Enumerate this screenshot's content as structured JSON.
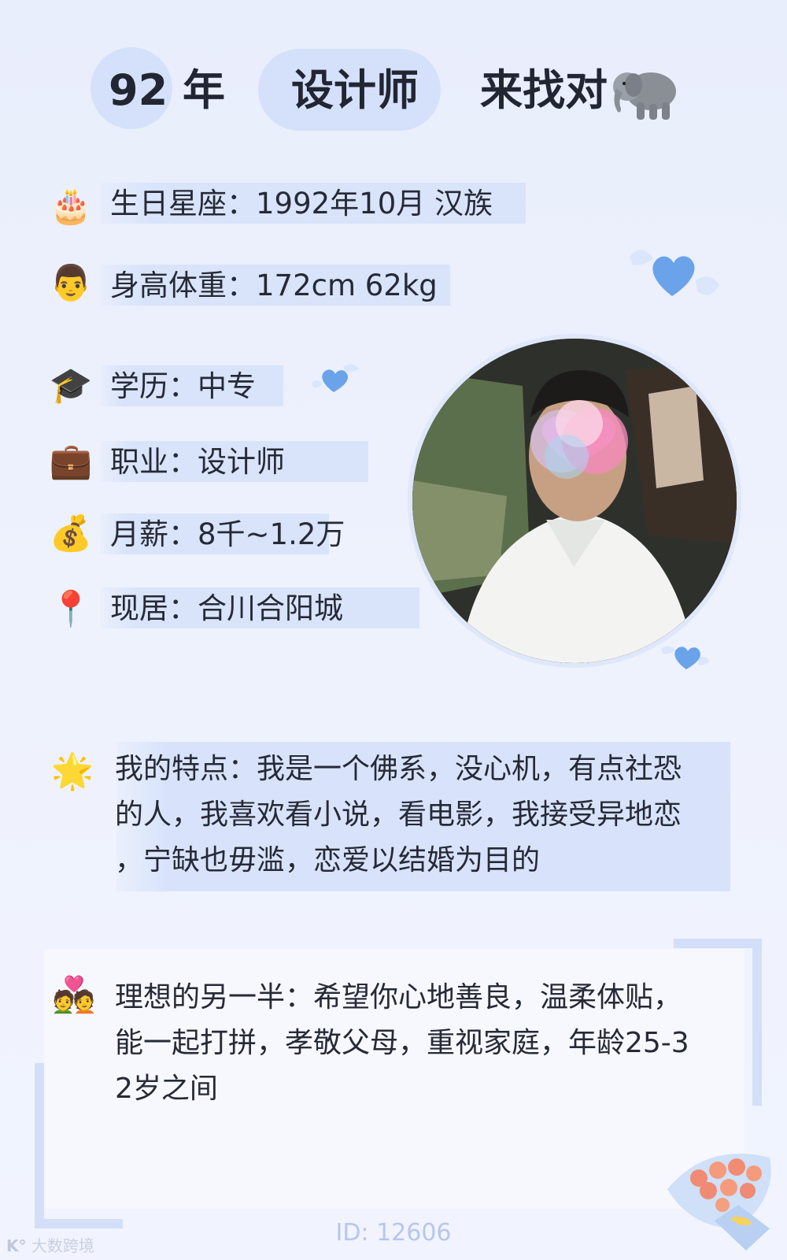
{
  "header": {
    "age": "92",
    "year_label": "年",
    "occupation": "设计师",
    "suffix": "来找对",
    "suffix_icon": "elephant-icon"
  },
  "info": {
    "birthday": {
      "icon": "birthday-cake-icon",
      "text": "生日星座：1992年10月 汉族"
    },
    "height_weight": {
      "icon": "man-face-icon",
      "text": "身高体重：172cm 62kg"
    },
    "education": {
      "icon": "graduation-cap-icon",
      "text": "学历：中专"
    },
    "job": {
      "icon": "briefcase-icon",
      "text": "职业：设计师"
    },
    "salary": {
      "icon": "money-bag-icon",
      "text": "月薪：8千~1.2万"
    },
    "residence": {
      "icon": "location-pin-icon",
      "text": "现居：合川合阳城"
    }
  },
  "traits": {
    "icon": "glowing-star-icon",
    "lines": [
      "我的特点：我是一个佛系，没心机，有点社恐",
      "的人，我喜欢看小说，看电影，我接受异地恋",
      "，宁缺也毋滥，恋爱以结婚为目的"
    ]
  },
  "ideal": {
    "icon": "couple-with-heart-icon",
    "lines": [
      "理想的另一半：希望你心地善良，温柔体贴，",
      "能一起打拼，孝敬父母，重视家庭，年龄25-3",
      "2岁之间"
    ]
  },
  "footer": {
    "id": "ID: 12606",
    "watermark": "大数跨境"
  },
  "colors": {
    "background": "#eef2fd",
    "accent_light": "#d9e4fb",
    "heart_blue": "#6aa3ea"
  }
}
